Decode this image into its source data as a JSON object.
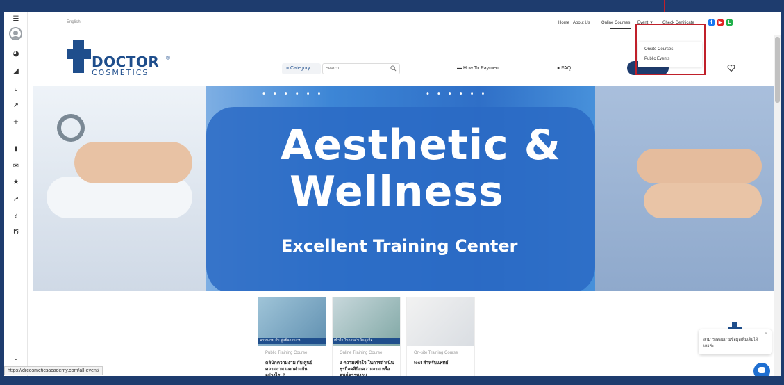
{
  "sidebar": {
    "icons": [
      "menu-icon",
      "avatar-icon",
      "dashboard-icon",
      "megaphone-icon",
      "chart-icon",
      "rocket-icon",
      "plus-icon",
      "book-icon",
      "mail-icon",
      "star-icon",
      "rocket-icon",
      "question-icon",
      "trophy-icon",
      "collapse-icon"
    ]
  },
  "topbar": {
    "language": "English",
    "nav": [
      "Home",
      "About Us",
      "Online Courses",
      "Event",
      "Check Certificate"
    ],
    "social_colors": [
      "#1877f2",
      "#e02424",
      "#21b04b"
    ]
  },
  "header": {
    "logo_text": "DOCTOR",
    "logo_sub": "COSMETICS",
    "logo_reg": "®",
    "category_label": "Category",
    "search_placeholder": "Search...",
    "how_to_pay": "How To Payment",
    "faq": "FAQ"
  },
  "dropdown": {
    "items": [
      "Onsite Courses",
      "Public Events"
    ]
  },
  "hero": {
    "title_line1": "Aesthetic &",
    "title_line2": "Wellness",
    "subtitle": "Excellent Training Center"
  },
  "cards": [
    {
      "strip": "ความงาม กับ ศูนย์ความงาม",
      "type": "Public Training Course",
      "title": "คลินิกความงาม กับ ศูนย์ความงาม แตกต่างกันอย่างไร..?"
    },
    {
      "strip": "เข้าใจ ในการดำเนินธุรกิจ",
      "type": "Online Training Course",
      "title": "3 ความเข้าใจ ในการดำเนินธุรกิจคลินิกความงาม หรือศูนย์ความงาม"
    },
    {
      "strip": "",
      "type": "On-site Training Course",
      "title": "test สำหรับแพทย์"
    }
  ],
  "chat": {
    "message": "สามารถสอบถามข้อมูลเพิ่มเติมได้เลยค่ะ",
    "close": "×"
  },
  "status_url": "https://drcosmeticsacademy.com/all-event/",
  "colors": {
    "brand": "#1f4e8c",
    "frame": "#1e3c6e",
    "highlight": "#c0202a"
  }
}
